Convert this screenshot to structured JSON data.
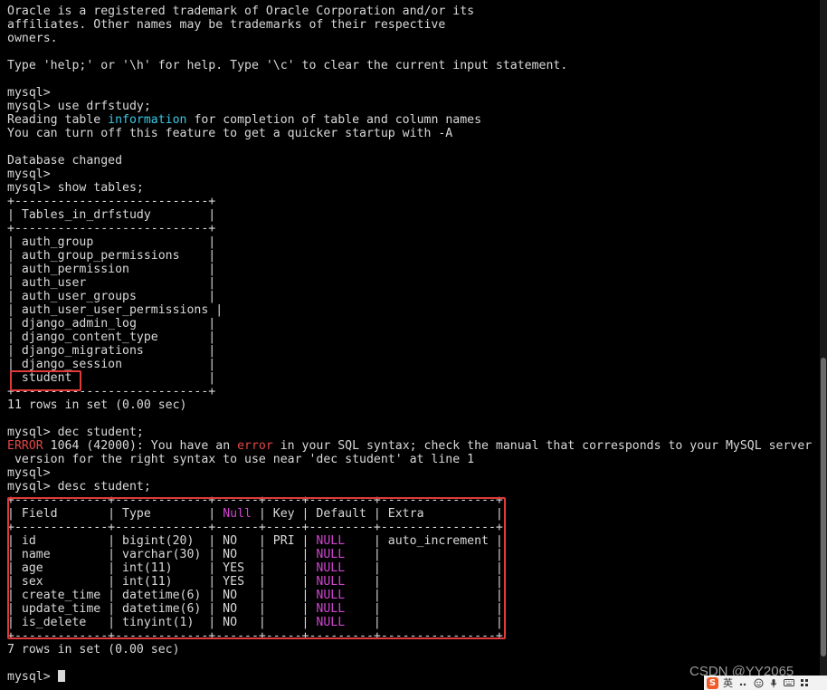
{
  "terminal": {
    "lines": [
      {
        "text": "Oracle is a registered trademark of Oracle Corporation and/or its"
      },
      {
        "text": "affiliates. Other names may be trademarks of their respective"
      },
      {
        "text": "owners."
      },
      {
        "text": ""
      },
      {
        "text": "Type 'help;' or '\\h' for help. Type '\\c' to clear the current input statement."
      },
      {
        "text": ""
      },
      {
        "text": "mysql>"
      },
      {
        "text": "mysql> use drfstudy;"
      },
      {
        "parts": [
          {
            "t": "Reading table "
          },
          {
            "t": "information",
            "c": "info"
          },
          {
            "t": " for completion of table and column names"
          }
        ]
      },
      {
        "text": "You can turn off this feature to get a quicker startup with -A"
      },
      {
        "text": ""
      },
      {
        "text": "Database changed"
      },
      {
        "text": "mysql>"
      },
      {
        "text": "mysql> show tables;"
      },
      {
        "text": "+---------------------------+"
      },
      {
        "text": "| Tables_in_drfstudy        |"
      },
      {
        "text": "+---------------------------+"
      },
      {
        "text": "| auth_group                |"
      },
      {
        "text": "| auth_group_permissions    |"
      },
      {
        "text": "| auth_permission           |"
      },
      {
        "text": "| auth_user                 |"
      },
      {
        "text": "| auth_user_groups          |"
      },
      {
        "text": "| auth_user_user_permissions |"
      },
      {
        "text": "| django_admin_log          |"
      },
      {
        "text": "| django_content_type       |"
      },
      {
        "text": "| django_migrations         |"
      },
      {
        "text": "| django_session            |"
      },
      {
        "text": "| student                   |"
      },
      {
        "text": "+---------------------------+"
      },
      {
        "text": "11 rows in set (0.00 sec)"
      },
      {
        "text": ""
      },
      {
        "text": "mysql> dec student;"
      },
      {
        "parts": [
          {
            "t": "ERROR",
            "c": "err"
          },
          {
            "t": " 1064 (42000): You have an "
          },
          {
            "t": "error",
            "c": "err"
          },
          {
            "t": " in your SQL syntax; check the manual that corresponds to your MySQL server"
          }
        ]
      },
      {
        "text": " version for the right syntax to use near 'dec student' at line 1"
      },
      {
        "text": "mysql>"
      },
      {
        "text": "mysql> desc student;"
      },
      {
        "text": "+-------------+-------------+------+-----+---------+----------------+"
      },
      {
        "parts": [
          {
            "t": "| Field       | Type        | "
          },
          {
            "t": "Null",
            "c": "null"
          },
          {
            "t": " | Key | Default | Extra          |"
          }
        ]
      },
      {
        "text": "+-------------+-------------+------+-----+---------+----------------+"
      },
      {
        "parts": [
          {
            "t": "| id          | bigint(20)  | NO   | PRI | "
          },
          {
            "t": "NULL",
            "c": "null"
          },
          {
            "t": "    | auto_increment |"
          }
        ]
      },
      {
        "parts": [
          {
            "t": "| name        | varchar(30) | NO   |     | "
          },
          {
            "t": "NULL",
            "c": "null"
          },
          {
            "t": "    |                |"
          }
        ]
      },
      {
        "parts": [
          {
            "t": "| age         | int(11)     | YES  |     | "
          },
          {
            "t": "NULL",
            "c": "null"
          },
          {
            "t": "    |                |"
          }
        ]
      },
      {
        "parts": [
          {
            "t": "| sex         | int(11)     | YES  |     | "
          },
          {
            "t": "NULL",
            "c": "null"
          },
          {
            "t": "    |                |"
          }
        ]
      },
      {
        "parts": [
          {
            "t": "| create_time | datetime(6) | NO   |     | "
          },
          {
            "t": "NULL",
            "c": "null"
          },
          {
            "t": "    |                |"
          }
        ]
      },
      {
        "parts": [
          {
            "t": "| update_time | datetime(6) | NO   |     | "
          },
          {
            "t": "NULL",
            "c": "null"
          },
          {
            "t": "    |                |"
          }
        ]
      },
      {
        "parts": [
          {
            "t": "| is_delete   | tinyint(1)  | NO   |     | "
          },
          {
            "t": "NULL",
            "c": "null"
          },
          {
            "t": "    |                |"
          }
        ]
      },
      {
        "text": "+-------------+-------------+------+-----+---------+----------------+"
      },
      {
        "text": "7 rows in set (0.00 sec)"
      },
      {
        "text": ""
      },
      {
        "text": "mysql> ",
        "cursor": true
      }
    ]
  },
  "colors": {
    "background": "#000000",
    "foreground": "#d9d9d9",
    "error": "#e04848",
    "info": "#38c8e6",
    "null": "#d046d0",
    "highlight_box": "#e03a3a"
  },
  "watermark": "CSDN @YY2065",
  "ime": {
    "logo": "S",
    "lang": "英",
    "icons": [
      "punctuation-icon",
      "emoji-icon",
      "microphone-icon",
      "keyboard-icon",
      "menu-grid-icon"
    ]
  }
}
